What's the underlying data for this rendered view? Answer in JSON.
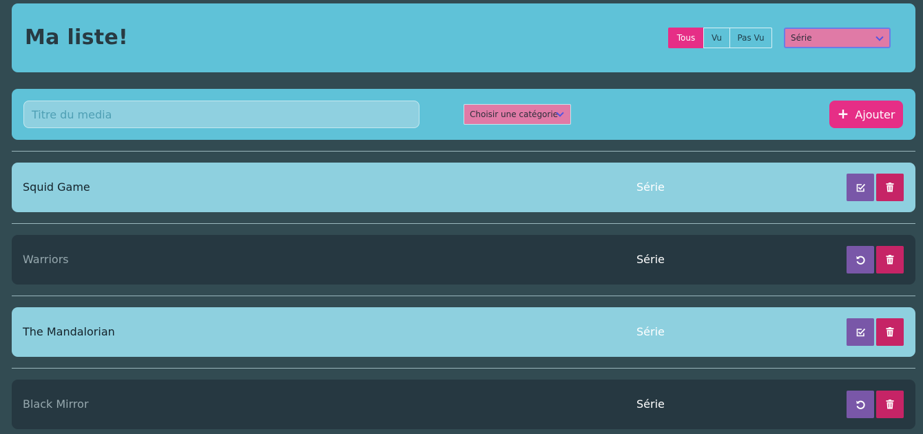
{
  "header": {
    "title": "Ma liste!",
    "filters": [
      {
        "label": "Tous",
        "active": true
      },
      {
        "label": "Vu",
        "active": false
      },
      {
        "label": "Pas Vu",
        "active": false
      }
    ],
    "category_filter": {
      "selected": "Série"
    }
  },
  "add_form": {
    "title_placeholder": "Titre du media",
    "category_select": {
      "selected": "Choisir une catégorie"
    },
    "add_label": "Ajouter"
  },
  "items": [
    {
      "title": "Squid Game",
      "category": "Série",
      "seen": false,
      "toggle_icon": "check-square-icon"
    },
    {
      "title": "Warriors",
      "category": "Série",
      "seen": true,
      "toggle_icon": "undo-icon"
    },
    {
      "title": "The Mandalorian",
      "category": "Série",
      "seen": false,
      "toggle_icon": "check-square-icon"
    },
    {
      "title": "Black Mirror",
      "category": "Série",
      "seen": true,
      "toggle_icon": "undo-icon"
    }
  ],
  "colors": {
    "background": "#324b52",
    "panel": "#5fc2d8",
    "accent": "#e62e86",
    "toggle_button": "#7957a8",
    "delete_button": "#c62466",
    "unseen_row": "#8ed0df",
    "seen_row": "#263841"
  }
}
